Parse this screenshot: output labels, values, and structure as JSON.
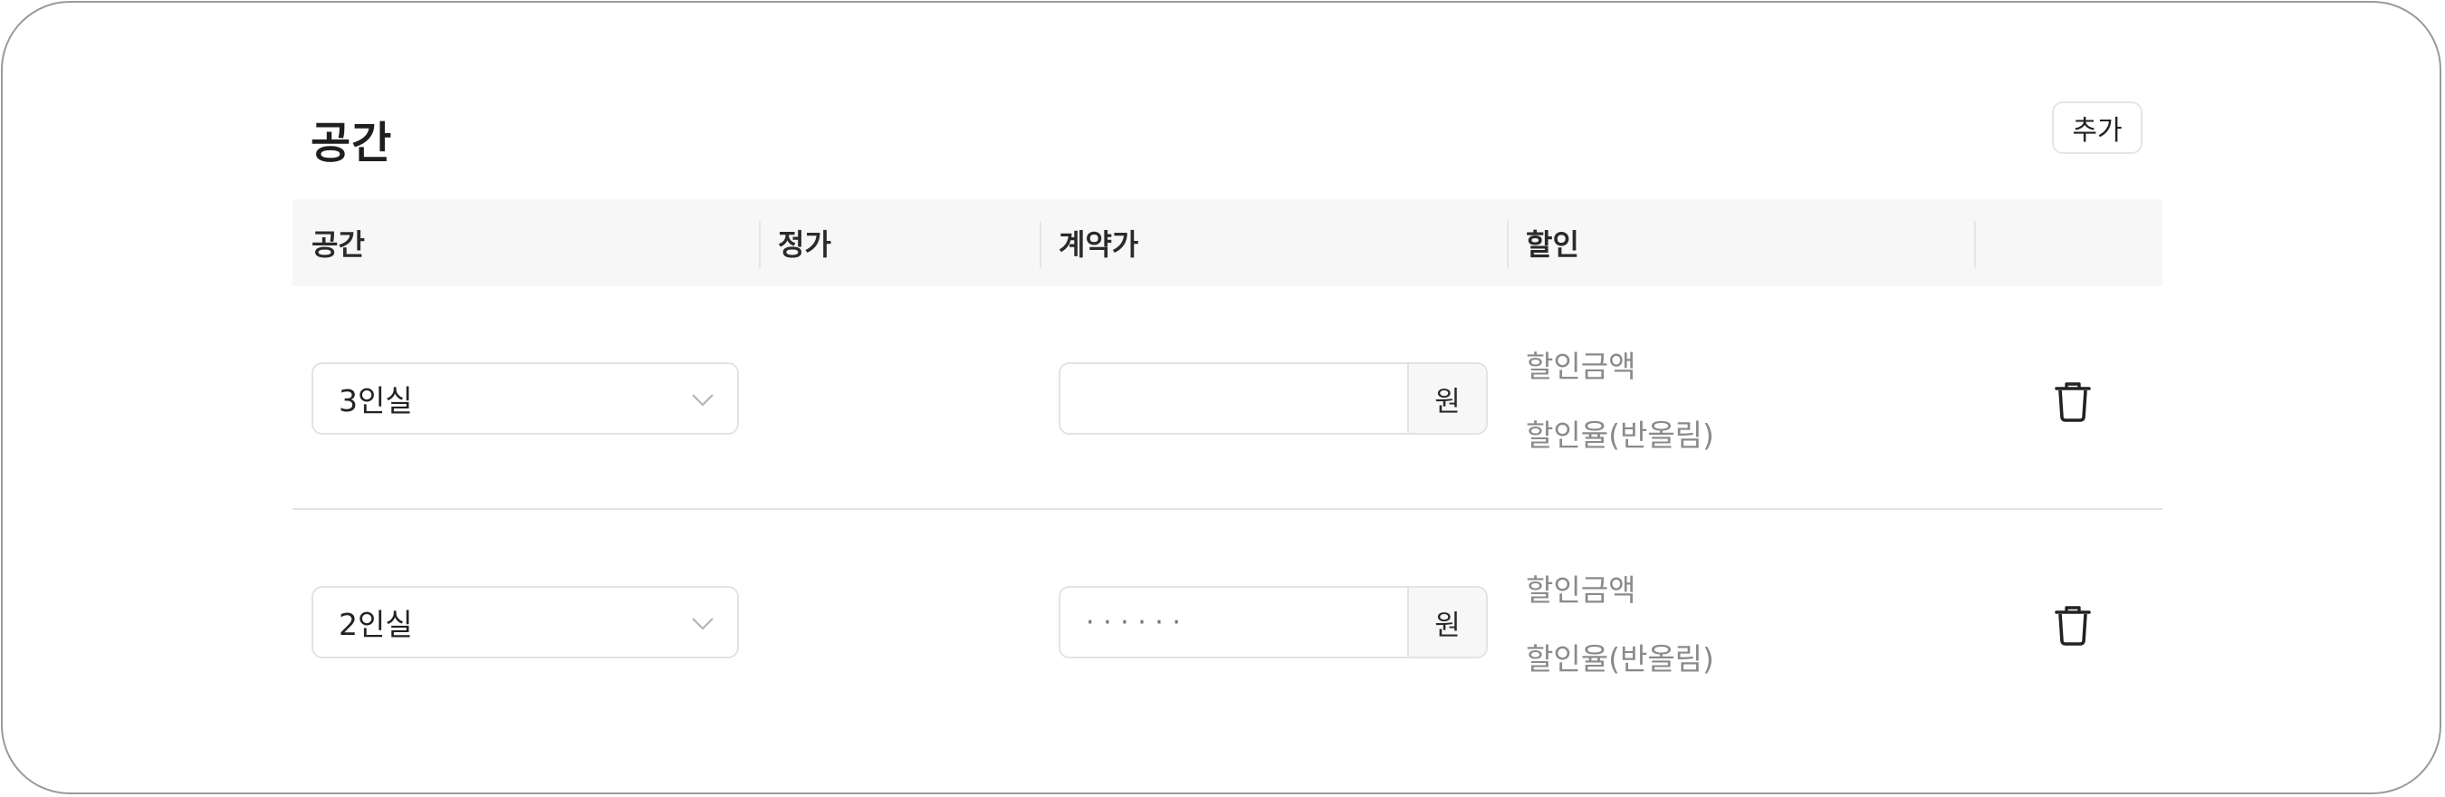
{
  "section": {
    "title": "공간",
    "add_label": "추가"
  },
  "columns": [
    "공간",
    "정가",
    "계약가",
    "할인",
    ""
  ],
  "rows": [
    {
      "space": "3인실",
      "list_price": "",
      "contract_price": "",
      "contract_placeholder": "",
      "unit": "원",
      "discount_amount_label": "할인금액",
      "discount_rate_label": "할인율(반올림)"
    },
    {
      "space": "2인실",
      "list_price": "",
      "contract_price": "",
      "contract_placeholder": "· · · · · ·",
      "unit": "원",
      "discount_amount_label": "할인금액",
      "discount_rate_label": "할인율(반올림)"
    }
  ],
  "icons": {
    "select": "chevron-down-icon",
    "delete": "trash-icon"
  },
  "colors": {
    "border": "#e3e3e3",
    "header_bg": "#f7f7f7",
    "muted_text": "#8a8a8a"
  }
}
